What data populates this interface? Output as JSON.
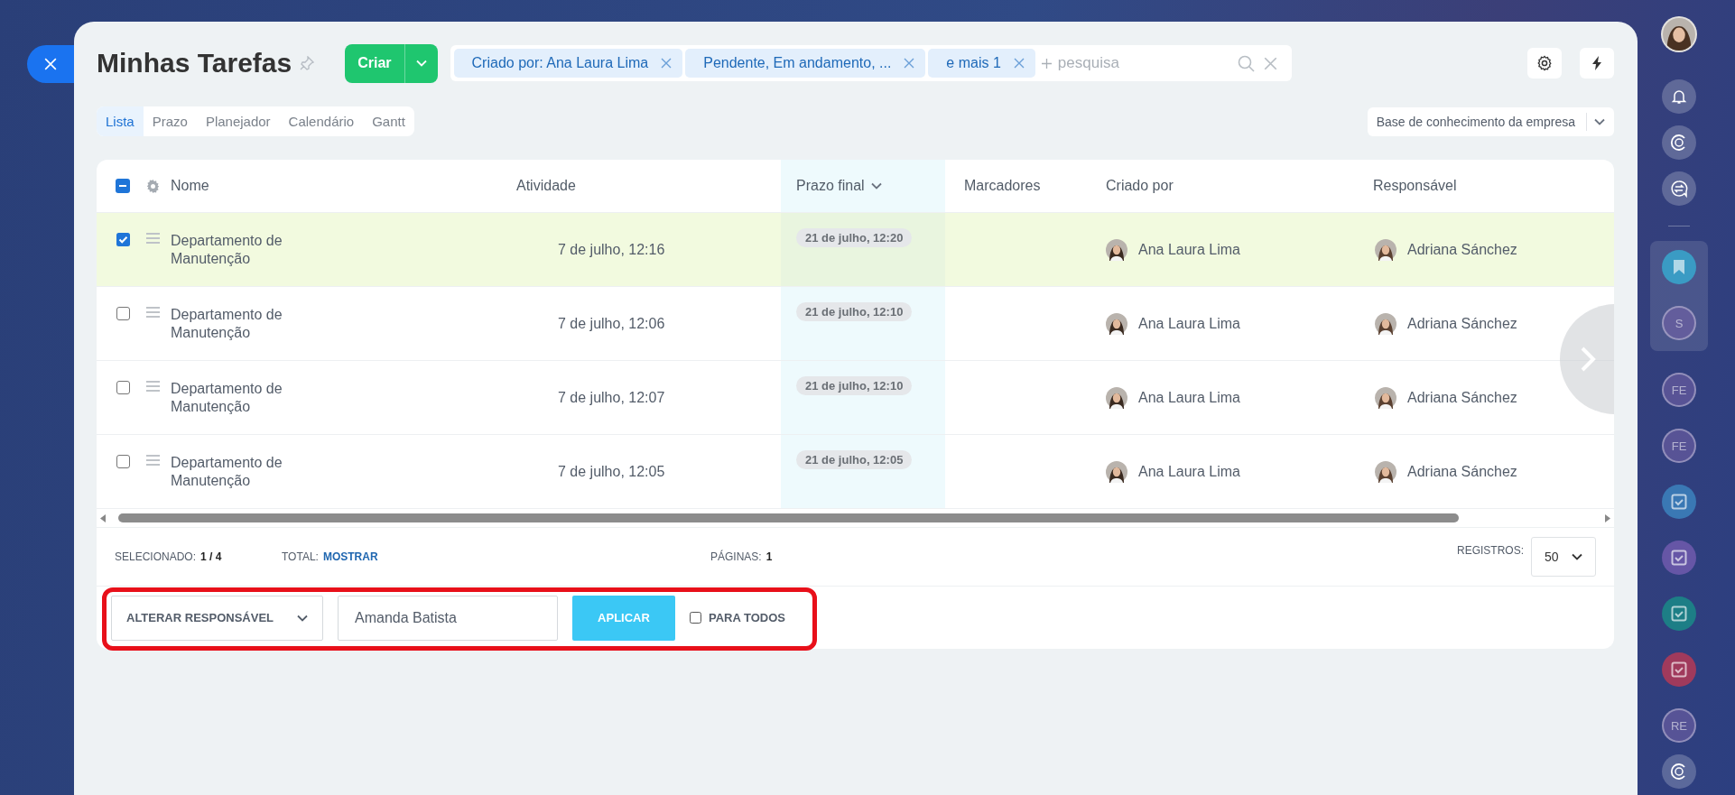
{
  "header": {
    "title": "Minhas Tarefas",
    "create_button": "Criar",
    "filters": [
      {
        "label": "Criado por: Ana Laura Lima"
      },
      {
        "label": "Pendente, Em andamento, ..."
      },
      {
        "label": "e mais 1"
      }
    ],
    "search": {
      "placeholder": "pesquisa"
    }
  },
  "tabs": [
    {
      "label": "Lista",
      "selected": true
    },
    {
      "label": "Prazo",
      "selected": false
    },
    {
      "label": "Planejador",
      "selected": false
    },
    {
      "label": "Calendário",
      "selected": false
    },
    {
      "label": "Gantt",
      "selected": false
    }
  ],
  "knowledge_base": "Base de conhecimento da empresa",
  "table": {
    "select_all": {
      "indeterminate": true
    },
    "columns": [
      {
        "label": "Nome",
        "sorted": false
      },
      {
        "label": "Atividade",
        "sorted": false
      },
      {
        "label": "Prazo final",
        "sorted": true
      },
      {
        "label": "Marcadores",
        "sorted": false
      },
      {
        "label": "Criado por",
        "sorted": false
      },
      {
        "label": "Responsável",
        "sorted": false
      }
    ],
    "rows": [
      {
        "checked": true,
        "name": "Departamento de Manutenção",
        "activity": "7 de julho, 12:16",
        "deadline": "21 de julho, 12:20",
        "created_by": "Ana Laura Lima",
        "responsible": "Adriana Sánchez"
      },
      {
        "checked": false,
        "name": "Departamento de Manutenção",
        "activity": "7 de julho, 12:06",
        "deadline": "21 de julho, 12:10",
        "created_by": "Ana Laura Lima",
        "responsible": "Adriana Sánchez"
      },
      {
        "checked": false,
        "name": "Departamento de Manutenção",
        "activity": "7 de julho, 12:07",
        "deadline": "21 de julho, 12:10",
        "created_by": "Ana Laura Lima",
        "responsible": "Adriana Sánchez"
      },
      {
        "checked": false,
        "name": "Departamento de Manutenção",
        "activity": "7 de julho, 12:05",
        "deadline": "21 de julho, 12:05",
        "created_by": "Ana Laura Lima",
        "responsible": "Adriana Sánchez"
      }
    ]
  },
  "footer": {
    "selected_label": "SELECIONADO:",
    "selected_value": "1 / 4",
    "total_label": "TOTAL:",
    "total_link": "MOSTRAR",
    "pages_label": "PÁGINAS:",
    "pages_value": "1",
    "records_label": "REGISTROS:",
    "records_value": "50"
  },
  "actions": {
    "action": "ALTERAR RESPONSÁVEL",
    "value": "Amanda Batista",
    "apply": "APLICAR",
    "for_all": {
      "label": "PARA TODOS",
      "checked": false
    }
  },
  "sidebar": {
    "top": [
      {
        "kind": "avatar"
      },
      {
        "kind": "bell"
      },
      {
        "kind": "assistant"
      },
      {
        "kind": "chat"
      }
    ],
    "pinned": [
      {
        "kind": "bookmark"
      },
      {
        "kind": "initials",
        "text": "S"
      }
    ],
    "items": [
      {
        "kind": "initials",
        "text": "FE"
      },
      {
        "kind": "initials",
        "text": "FE"
      },
      {
        "kind": "task",
        "color": "#3a78b4"
      },
      {
        "kind": "task",
        "color": "#6656a6"
      },
      {
        "kind": "task",
        "color": "#1d7e86"
      },
      {
        "kind": "task",
        "color": "#a03a5c"
      },
      {
        "kind": "initials",
        "text": "RE"
      },
      {
        "kind": "assistant"
      }
    ]
  }
}
